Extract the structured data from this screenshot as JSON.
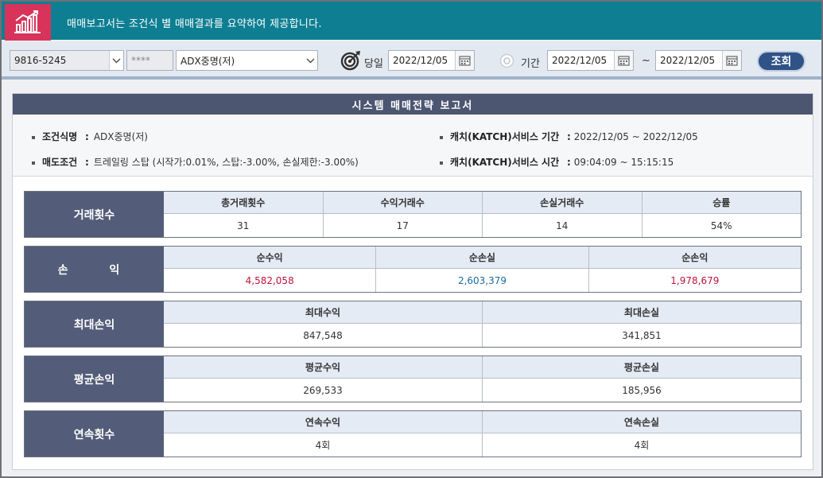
{
  "banner": {
    "text": "매매보고서는 조건식 별 매매결과를 요약하여 제공합니다."
  },
  "toolbar": {
    "account": "9816-5245",
    "password": "****",
    "condition": "ADX중명(저)",
    "today_label": "당일",
    "today_date": "2022/12/05",
    "period_label": "기간",
    "period_from": "2022/12/05",
    "tilde": "~",
    "period_to": "2022/12/05",
    "query_label": "조회"
  },
  "report": {
    "title": "시스템 매매전략 보고서",
    "condition_name_label": "조건식명",
    "condition_name": "ADX중명(저)",
    "sell_condition_label": "매도조건",
    "sell_condition": "트레일링 스탑 (시작가:0.01%, 스탑:-3.00%, 손실제한:-3.00%)",
    "service_period_label": "캐치(KATCH)서비스 기간",
    "service_period": "2022/12/05 ~ 2022/12/05",
    "service_time_label": "캐치(KATCH)서비스 시간",
    "service_time": "09:04:09 ~ 15:15:15",
    "colon": ":"
  },
  "sections": {
    "trades": {
      "title": "거래횟수",
      "cols": [
        {
          "header": "총거래횟수",
          "value": "31"
        },
        {
          "header": "수익거래수",
          "value": "17"
        },
        {
          "header": "손실거래수",
          "value": "14"
        },
        {
          "header": "승률",
          "value": "54%"
        }
      ]
    },
    "pnl": {
      "title": "손  익",
      "cols": [
        {
          "header": "순수익",
          "value": "4,582,058"
        },
        {
          "header": "순손실",
          "value": "2,603,379"
        },
        {
          "header": "순손익",
          "value": "1,978,679"
        }
      ]
    },
    "max": {
      "title": "최대손익",
      "cols": [
        {
          "header": "최대수익",
          "value": "847,548"
        },
        {
          "header": "최대손실",
          "value": "341,851"
        }
      ]
    },
    "avg": {
      "title": "평균손익",
      "cols": [
        {
          "header": "평균수익",
          "value": "269,533"
        },
        {
          "header": "평균손실",
          "value": "185,956"
        }
      ]
    },
    "streak": {
      "title": "연속횟수",
      "cols": [
        {
          "header": "연속수익",
          "value": "4회"
        },
        {
          "header": "연속손실",
          "value": "4회"
        }
      ]
    }
  },
  "colors": {
    "banner": "#0e7f92",
    "icon_bg": "#d8335a",
    "header": "#535c78",
    "profit": "#c0143c",
    "loss": "#1b6aa8"
  }
}
